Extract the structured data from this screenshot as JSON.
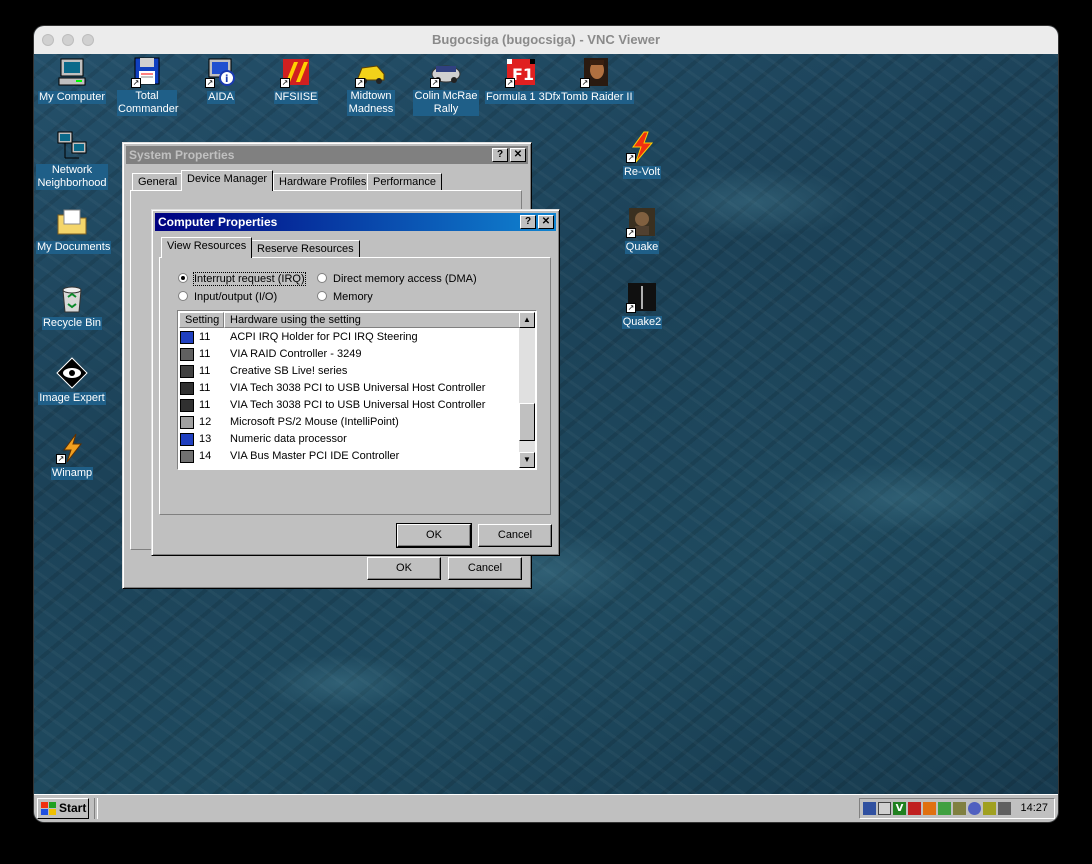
{
  "mac": {
    "window_title": "Bugocsiga (bugocsiga) - VNC Viewer"
  },
  "desktop_icons": [
    {
      "name": "my-computer",
      "label": "My Computer"
    },
    {
      "name": "total-commander",
      "label": "Total Commander"
    },
    {
      "name": "aida",
      "label": "AIDA"
    },
    {
      "name": "nfsiise",
      "label": "NFSIISE"
    },
    {
      "name": "midtown-madness",
      "label": "Midtown Madness"
    },
    {
      "name": "colin-mcrae-rally",
      "label": "Colin McRae Rally"
    },
    {
      "name": "formula1-3dfx",
      "label": "Formula 1 3Dfx"
    },
    {
      "name": "tomb-raider-ii",
      "label": "Tomb Raider II"
    },
    {
      "name": "network-neighborhood",
      "label": "Network Neighborhood"
    },
    {
      "name": "my-documents",
      "label": "My Documents"
    },
    {
      "name": "recycle-bin",
      "label": "Recycle Bin"
    },
    {
      "name": "image-expert",
      "label": "Image Expert"
    },
    {
      "name": "winamp",
      "label": "Winamp"
    },
    {
      "name": "re-volt",
      "label": "Re-Volt"
    },
    {
      "name": "quake",
      "label": "Quake"
    },
    {
      "name": "quake2",
      "label": "Quake2"
    }
  ],
  "sysprops": {
    "title": "System Properties",
    "tabs": [
      "General",
      "Device Manager",
      "Hardware Profiles",
      "Performance"
    ],
    "ok": "OK",
    "cancel": "Cancel"
  },
  "compprops": {
    "title": "Computer Properties",
    "tabs": [
      "View Resources",
      "Reserve Resources"
    ],
    "radios": [
      {
        "label": "Interrupt request (IRQ)",
        "selected": true
      },
      {
        "label": "Direct memory access (DMA)",
        "selected": false
      },
      {
        "label": "Input/output (I/O)",
        "selected": false
      },
      {
        "label": "Memory",
        "selected": false
      }
    ],
    "columns": [
      "Setting",
      "Hardware using the setting"
    ],
    "rows": [
      {
        "setting": "11",
        "hardware": "ACPI IRQ Holder for PCI IRQ Steering",
        "icon": "monitor-icon"
      },
      {
        "setting": "11",
        "hardware": "VIA RAID Controller - 3249",
        "icon": "controller-icon"
      },
      {
        "setting": "11",
        "hardware": "Creative SB Live! series",
        "icon": "sound-icon"
      },
      {
        "setting": "11",
        "hardware": "VIA Tech 3038 PCI to USB Universal Host Controller",
        "icon": "usb-icon"
      },
      {
        "setting": "11",
        "hardware": "VIA Tech 3038 PCI to USB Universal Host Controller",
        "icon": "usb-icon"
      },
      {
        "setting": "12",
        "hardware": "Microsoft PS/2 Mouse (IntelliPoint)",
        "icon": "mouse-icon"
      },
      {
        "setting": "13",
        "hardware": "Numeric data processor",
        "icon": "monitor-icon"
      },
      {
        "setting": "14",
        "hardware": "VIA Bus Master PCI IDE Controller",
        "icon": "drive-icon"
      }
    ],
    "ok": "OK",
    "cancel": "Cancel"
  },
  "taskbar": {
    "start": "Start",
    "clock": "14:27"
  }
}
